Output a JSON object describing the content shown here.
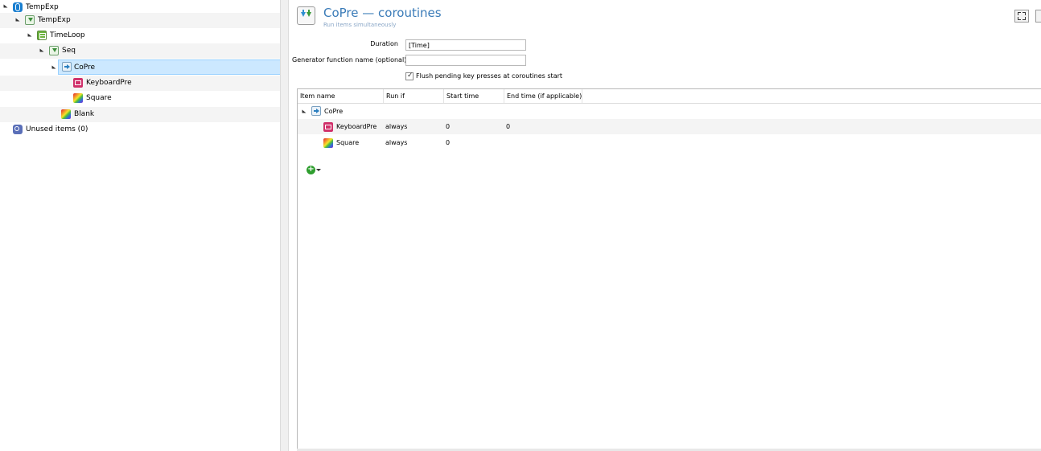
{
  "tree": {
    "items": [
      {
        "label": "TempExp",
        "icon": "experiment-icon"
      },
      {
        "label": "TempExp",
        "icon": "procedure-icon"
      },
      {
        "label": "TimeLoop",
        "icon": "loop-icon"
      },
      {
        "label": "Seq",
        "icon": "sequence-icon"
      },
      {
        "label": "CoPre",
        "icon": "coroutine-icon"
      },
      {
        "label": "KeyboardPre",
        "icon": "keyboard-icon"
      },
      {
        "label": "Square",
        "icon": "sketchpad-icon"
      },
      {
        "label": "Blank",
        "icon": "sketchpad-icon"
      },
      {
        "label": "Unused items (0)",
        "icon": "unused-items-icon"
      }
    ]
  },
  "header": {
    "title": "CoPre — coroutines",
    "subtitle": "Run items simultaneously"
  },
  "form": {
    "duration_label": "Duration",
    "duration_value": "[Time]",
    "generator_label": "Generator function name (optional)",
    "generator_value": "",
    "flush_label": "Flush pending key presses at coroutines start",
    "flush_checked": true
  },
  "grid": {
    "columns": [
      "Item name",
      "Run if",
      "Start time",
      "End time (if applicable)"
    ],
    "parent": "CoPre",
    "rows": [
      {
        "name": "KeyboardPre",
        "run_if": "always",
        "start": "0",
        "end": "0",
        "icon": "keyboard-icon"
      },
      {
        "name": "Square",
        "run_if": "always",
        "start": "0",
        "end": "",
        "icon": "sketchpad-icon"
      }
    ]
  },
  "colors": {
    "title": "#3a7bb8",
    "selection": "#cce8ff",
    "add": "#2e9e2e"
  }
}
